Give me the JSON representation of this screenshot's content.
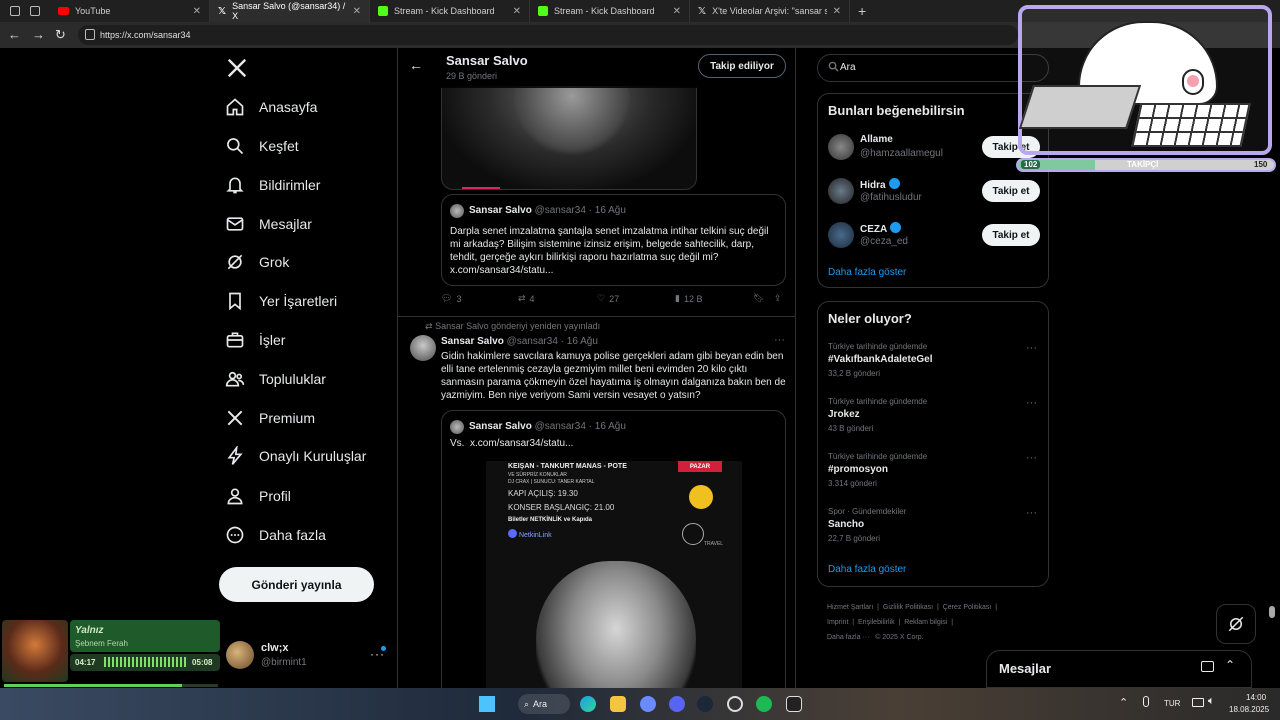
{
  "browser": {
    "tabs": [
      {
        "label": "YouTube",
        "color": "#ff0000"
      },
      {
        "label": "Sansar Salvo (@sansar34) / X",
        "color": "#ffffff",
        "active": true
      },
      {
        "label": "Stream - Kick Dashboard",
        "color": "#53fc18"
      },
      {
        "label": "Stream - Kick Dashboard",
        "color": "#53fc18"
      },
      {
        "label": "X'te Videolar Arşivi: \"sansar salvo",
        "color": "#ffffff"
      }
    ],
    "url": "https://x.com/sansar34"
  },
  "left_nav": {
    "items": [
      {
        "label": "Anasayfa",
        "icon": "home-icon"
      },
      {
        "label": "Keşfet",
        "icon": "search-icon"
      },
      {
        "label": "Bildirimler",
        "icon": "bell-icon"
      },
      {
        "label": "Mesajlar",
        "icon": "mail-icon"
      },
      {
        "label": "Grok",
        "icon": "grok-icon"
      },
      {
        "label": "Yer İşaretleri",
        "icon": "bookmark-icon"
      },
      {
        "label": "İşler",
        "icon": "briefcase-icon"
      },
      {
        "label": "Topluluklar",
        "icon": "people-icon"
      },
      {
        "label": "Premium",
        "icon": "x-logo-icon"
      },
      {
        "label": "Onaylı Kuruluşlar",
        "icon": "lightning-icon"
      },
      {
        "label": "Profil",
        "icon": "person-icon"
      },
      {
        "label": "Daha fazla",
        "icon": "more-circle-icon"
      }
    ],
    "post_button": "Gönderi yayınla",
    "account": {
      "name": "clw;x",
      "handle": "@birmint1"
    }
  },
  "header": {
    "name": "Sansar Salvo",
    "posts": "29 B gönderi",
    "following_button": "Takip ediliyor"
  },
  "tweet1": {
    "quote": {
      "name": "Sansar Salvo",
      "meta": "@sansar34 · 16 Ağu",
      "text": "Darpla senet imzalatma şantajla senet imzalatma intihar telkini suç değil mi arkadaş? Bilişim sistemine izinsiz erişim, belgede sahtecilik, darp, tehdit, gerçeğe aykırı bilirkişi raporu hazırlatma suç değil mi? x.com/sansar34/statu..."
    },
    "metrics": {
      "replies": "3",
      "reposts": "4",
      "likes": "27",
      "views": "12 B"
    }
  },
  "tweet2": {
    "repost_label": "Sansar Salvo gönderiyi yeniden yayınladı",
    "name": "Sansar Salvo",
    "meta": "@sansar34 · 16 Ağu",
    "text": "Gidin hakimlere savcılara kamuya polise gerçekleri adam gibi beyan edin ben elli tane ertelenmiş cezayla gezmiyim millet beni evimden 20 kilo çıktı sanmasın parama çökmeyin özel hayatıma iş olmayın dalganıza bakın ben de yazmiyim. Ben niye veriyom Sami versin vesayet o yatsın?",
    "quote": {
      "name": "Sansar Salvo",
      "meta": "@sansar34 · 16 Ağu",
      "text": "Vs.  x.com/sansar34/statu..."
    },
    "poster": {
      "title": "KEIŞAN - TANKURT MANAS - POTE",
      "line2": "VE SÜRPRİZ KONUKLAR",
      "line3": "DJ CRAX | SUNUCU: TANER KARTAL",
      "door": "KAPI AÇILIŞ: 19.30",
      "concert": "KONSER BAŞLANGIÇ: 21.00",
      "tickets": "Biletler NETKİNLİK ve Kapıda",
      "brand": "NetkinLink",
      "day": "PAZAR",
      "travel": "TRAVEL"
    }
  },
  "right": {
    "search_placeholder": "Ara",
    "who_to_follow": {
      "title": "Bunları beğenebilirsin",
      "users": [
        {
          "name": "Allame",
          "handle": "@hamzaallamegul",
          "verified": false
        },
        {
          "name": "Hidra",
          "handle": "@fatihusludur",
          "verified": true
        },
        {
          "name": "CEZA",
          "handle": "@ceza_ed",
          "verified": true
        }
      ],
      "follow_label": "Takip et",
      "show_more": "Daha fazla göster"
    },
    "trends": {
      "title": "Neler oluyor?",
      "items": [
        {
          "context": "Türkiye tarihinde gündemde",
          "name": "#VakıfbankAdaleteGel",
          "count": "33,2 B gönderi"
        },
        {
          "context": "Türkiye tarihinde gündemde",
          "name": "Jrokez",
          "count": "43 B gönderi"
        },
        {
          "context": "Türkiye tarihinde gündemde",
          "name": "#promosyon",
          "count": "3.314 gönderi"
        },
        {
          "context": "Spor · Gündemdekiler",
          "name": "Sancho",
          "count": "22,7 B gönderi"
        }
      ],
      "show_more": "Daha fazla göster"
    },
    "footer": [
      "Hizmet Şartları",
      "Gizlilik Politikası",
      "Çerez Politikası",
      "Imprint",
      "Erişilebilirlik",
      "Reklam bilgisi",
      "Daha fazla ···",
      "© 2025 X Corp."
    ],
    "messages_label": "Mesajlar"
  },
  "overlay": {
    "left_count": "102",
    "label": "TAKİPÇİ",
    "right_count": "150",
    "progress": 0.3
  },
  "music": {
    "title": "Yalnız",
    "artist": "Şebnem Ferah",
    "elapsed": "04:17",
    "total": "05:08",
    "progress": 0.83
  },
  "taskbar": {
    "search": "Ara",
    "lang": "TUR",
    "time": "14:00",
    "date": "18.08.2025"
  }
}
